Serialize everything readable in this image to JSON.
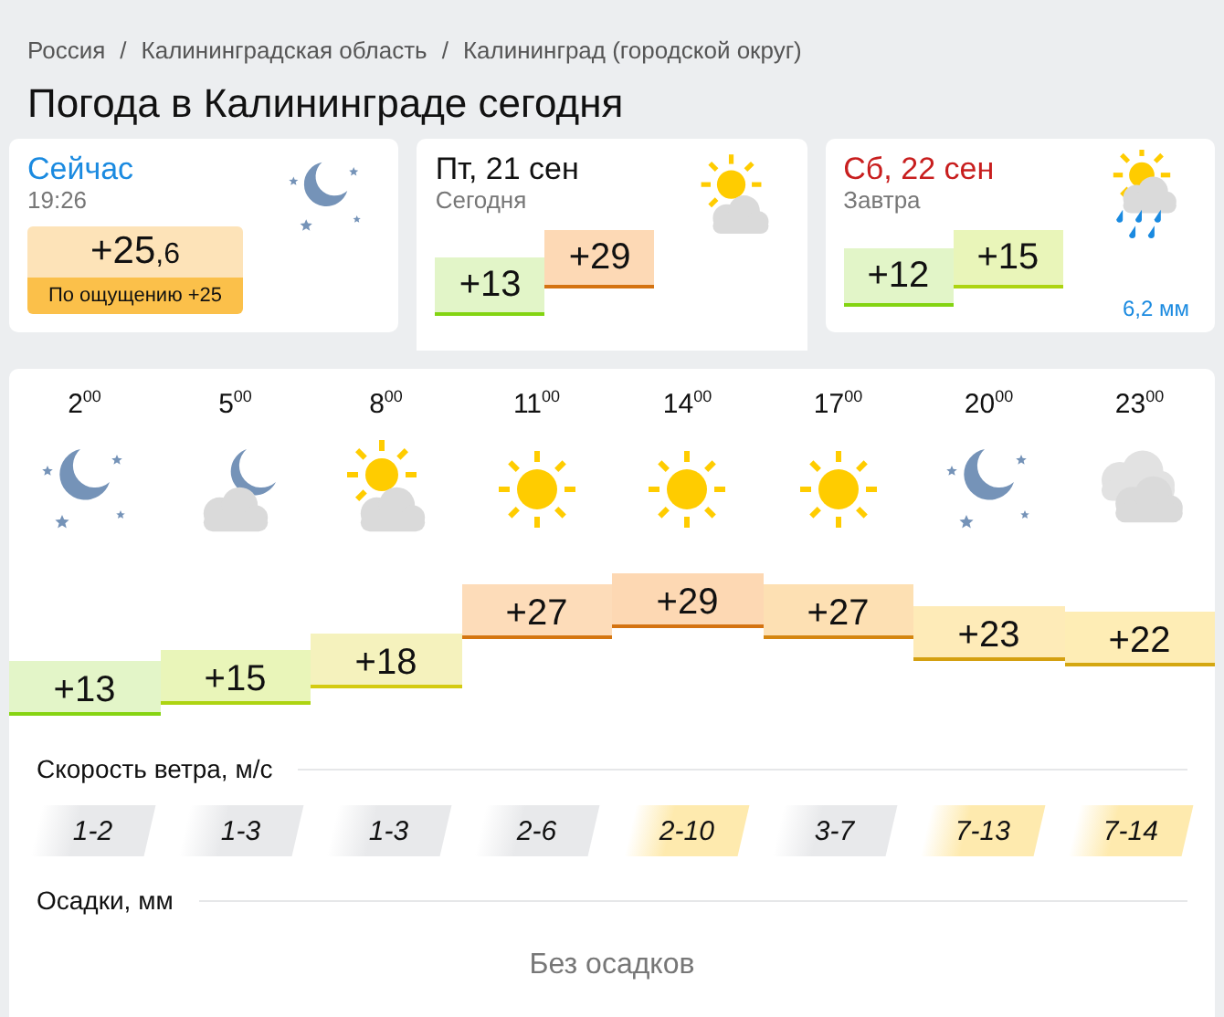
{
  "breadcrumbs": [
    "Россия",
    "Калининградская область",
    "Калининград (городской округ)"
  ],
  "separator": "/",
  "title": "Погода в Калининграде сегодня",
  "cards": [
    {
      "kind": "now",
      "heading": "Сейчас",
      "time": "19:26",
      "icon": {
        "kind": "moon-stars"
      },
      "temp": "+25",
      "temp_fraction": ",6",
      "feels_like": "По ощущению +25",
      "selected": false
    },
    {
      "kind": "day",
      "heading": "Пт, 21 сен",
      "subheading": "Сегодня",
      "weekend": false,
      "selected": true,
      "icon": {
        "kind": "sun-cloud"
      },
      "temps": [
        {
          "text": "+13",
          "color": "#e2f5c8"
        },
        {
          "text": "+29",
          "color": "#fdd9b5"
        }
      ]
    },
    {
      "kind": "day",
      "heading": "Сб, 22 сен",
      "subheading": "Завтра",
      "weekend": true,
      "selected": false,
      "icon": {
        "kind": "sun-cloud-rain"
      },
      "precipitation": "6,2 мм",
      "temps": [
        {
          "text": "+12",
          "color": "#e2f5c8"
        },
        {
          "text": "+15",
          "color": "#e9f5b9"
        }
      ]
    }
  ],
  "hourly": {
    "hours": [
      {
        "time": "2$^{00}$",
        "icon": {
          "kind": "moon-stars"
        },
        "temp": {
          "text": "+13",
          "color": "#e3f5c8"
        },
        "wind": {
          "text": "1-2",
          "color": "#e8e9eb"
        }
      },
      {
        "time": "5$^{00}$",
        "icon": {
          "kind": "moon-cloud"
        },
        "temp": {
          "text": "+15",
          "color": "#e9f5b9"
        },
        "wind": {
          "text": "1-3",
          "color": "#e8e9eb"
        }
      },
      {
        "time": "8$^{00}$",
        "icon": {
          "kind": "sun-cloud"
        },
        "temp": {
          "text": "+18",
          "color": "#f5f2bd"
        },
        "wind": {
          "text": "1-3",
          "color": "#e8e9eb"
        }
      },
      {
        "time": "11$^{00}$",
        "icon": {
          "kind": "sun"
        },
        "temp": {
          "text": "+27",
          "color": "#fddcb9"
        },
        "wind": {
          "text": "2-6",
          "color": "#e8e9eb"
        }
      },
      {
        "time": "14$^{00}$",
        "icon": {
          "kind": "sun"
        },
        "temp": {
          "text": "+29",
          "color": "#fdd8b3"
        },
        "wind": {
          "text": "2-10",
          "color": "#feeaae"
        }
      },
      {
        "time": "17$^{00}$",
        "icon": {
          "kind": "sun"
        },
        "temp": {
          "text": "+27",
          "color": "#fde0b3"
        },
        "wind": {
          "text": "3-7",
          "color": "#e8e9eb"
        }
      },
      {
        "time": "20$^{00}$",
        "icon": {
          "kind": "moon-stars"
        },
        "temp": {
          "text": "+23",
          "color": "#feebb8"
        },
        "wind": {
          "text": "7-13",
          "color": "#feeaae"
        }
      },
      {
        "time": "23$^{00}$",
        "icon": {
          "kind": "clouds"
        },
        "temp": {
          "text": "+22",
          "color": "#feedb5"
        },
        "wind": {
          "text": "7-14",
          "color": "#feeaae"
        }
      }
    ],
    "wind_label": "Скорость ветра, м/с",
    "precip_label": "Осадки, мм",
    "precip_text": "Без осадков"
  }
}
